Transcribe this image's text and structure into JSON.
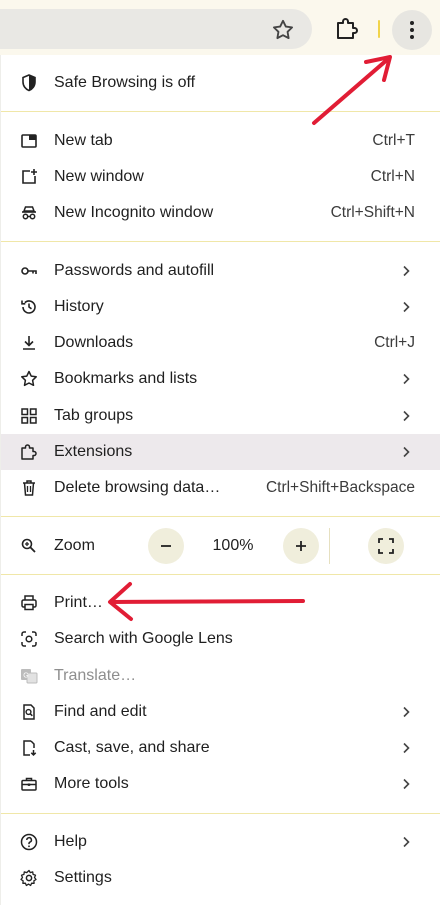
{
  "colors": {
    "accent_arrow": "#e11d35",
    "separator": "#f0e7a8",
    "highlight": "#ede9ec"
  },
  "menu": {
    "safe_browsing": "Safe Browsing is off",
    "new_tab": {
      "label": "New tab",
      "shortcut": "Ctrl+T"
    },
    "new_window": {
      "label": "New window",
      "shortcut": "Ctrl+N"
    },
    "new_incognito": {
      "label": "New Incognito window",
      "shortcut": "Ctrl+Shift+N"
    },
    "passwords": "Passwords and autofill",
    "history": "History",
    "downloads": {
      "label": "Downloads",
      "shortcut": "Ctrl+J"
    },
    "bookmarks": "Bookmarks and lists",
    "tab_groups": "Tab groups",
    "extensions": "Extensions",
    "delete_data": {
      "label": "Delete browsing data…",
      "shortcut": "Ctrl+Shift+Backspace"
    },
    "zoom": {
      "label": "Zoom",
      "value": "100%"
    },
    "print": "Print…",
    "lens": "Search with Google Lens",
    "translate": "Translate…",
    "find": "Find and edit",
    "cast": "Cast, save, and share",
    "more_tools": "More tools",
    "help": "Help",
    "settings": "Settings"
  },
  "icons": {
    "omnibox": "bookmark-star-icon",
    "extensions_toolbar": "puzzle-icon",
    "menu_button": "three-dot-menu-icon"
  }
}
